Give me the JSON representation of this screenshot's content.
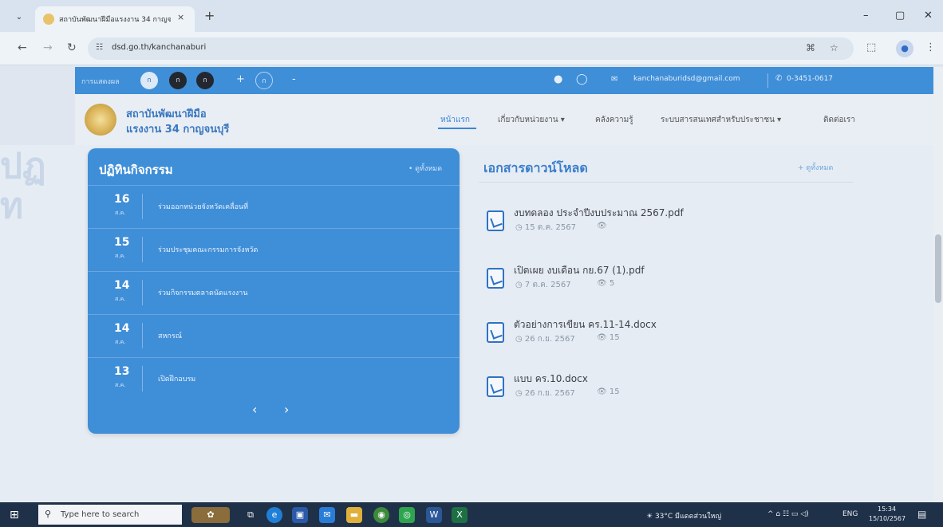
{
  "browser": {
    "tab_title": "สถาบันพัฒนาฝีมือแรงงาน 34 กาญจ...",
    "tab_close": "×",
    "new_tab": "+",
    "url": "dsd.go.th/kanchanaburi",
    "tab_menu": "⌄",
    "minimize": "–",
    "restore": "▢",
    "close": "✕"
  },
  "topbar": {
    "label": "การแสดงผล",
    "circles": [
      "ก",
      "ก",
      "ก",
      "ก"
    ],
    "plus": "+",
    "minus": "-",
    "email": "kanchanaburidsd@gmail.com",
    "phone": "0-3451-0617"
  },
  "header": {
    "org_line1": "สถาบันพัฒนาฝีมือ",
    "org_line2": "แรงงาน 34 กาญจนบุรี",
    "menu": [
      "หน้าแรก",
      "เกี่ยวกับหน่วยงาน ▾",
      "คลังความรู้",
      "ระบบสารสนเทศสำหรับประชาชน ▾",
      "ติดต่อเรา"
    ]
  },
  "activities": {
    "title": "ปฏิทินกิจกรรม",
    "view_all": "• ดูทั้งหมด",
    "items": [
      {
        "day": "16",
        "month": "ส.ค.",
        "text": "ร่วมออกหน่วยจังหวัดเคลื่อนที่"
      },
      {
        "day": "15",
        "month": "ส.ค.",
        "text": "ร่วมประชุมคณะกรรมการจังหวัด"
      },
      {
        "day": "14",
        "month": "ส.ค.",
        "text": "ร่วมกิจกรรมตลาดนัดแรงงาน"
      },
      {
        "day": "14",
        "month": "ส.ค.",
        "text": "สหกรณ์"
      },
      {
        "day": "13",
        "month": "ส.ค.",
        "text": "เปิดฝึกอบรม"
      }
    ],
    "prev": "‹",
    "next": "›"
  },
  "downloads": {
    "title": "เอกสารดาวน์โหลด",
    "view_all": "+ ดูทั้งหมด",
    "items": [
      {
        "name": "งบทดลอง ประจำปีงบประมาณ 2567.pdf",
        "date": "15 ต.ค. 2567",
        "views": ""
      },
      {
        "name": "เปิดเผย งบเดือน กย.67 (1).pdf",
        "date": "7 ต.ค. 2567",
        "views": "5"
      },
      {
        "name": "ตัวอย่างการเขียน คร.11-14.docx",
        "date": "26 ก.ย. 2567",
        "views": "15"
      },
      {
        "name": "แบบ คร.10.docx",
        "date": "26 ก.ย. 2567",
        "views": "15"
      }
    ]
  },
  "taskbar": {
    "search_placeholder": "Type here to search",
    "weather": "33°C มีแดดส่วนใหญ่",
    "lang": "ENG",
    "time": "15:34",
    "date": "15/10/2567"
  },
  "colors": {
    "primary_blue": "#3f8ed8",
    "title_blue": "#3a7fcc",
    "taskbar": "#1f3148"
  }
}
